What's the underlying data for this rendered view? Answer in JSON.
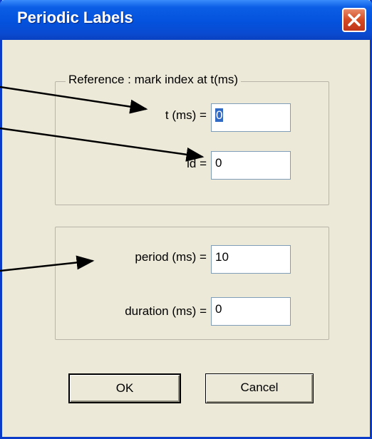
{
  "dialog": {
    "title": "Periodic Labels"
  },
  "reference_group": {
    "caption": "Reference : mark index at t(ms)",
    "t_label": "t (ms) =",
    "t_value": "0",
    "id_label": "id =",
    "id_value": "0"
  },
  "period_group": {
    "period_label": "period (ms) =",
    "period_value": "10",
    "duration_label": "duration (ms) =",
    "duration_value": "0"
  },
  "buttons": {
    "ok": "OK",
    "cancel": "Cancel"
  },
  "icons": {
    "close": "close-icon"
  },
  "colors": {
    "titlebar": "#0452dd",
    "close_button": "#d44a22",
    "dialog_face": "#ece9d8",
    "selection": "#316ac5"
  }
}
